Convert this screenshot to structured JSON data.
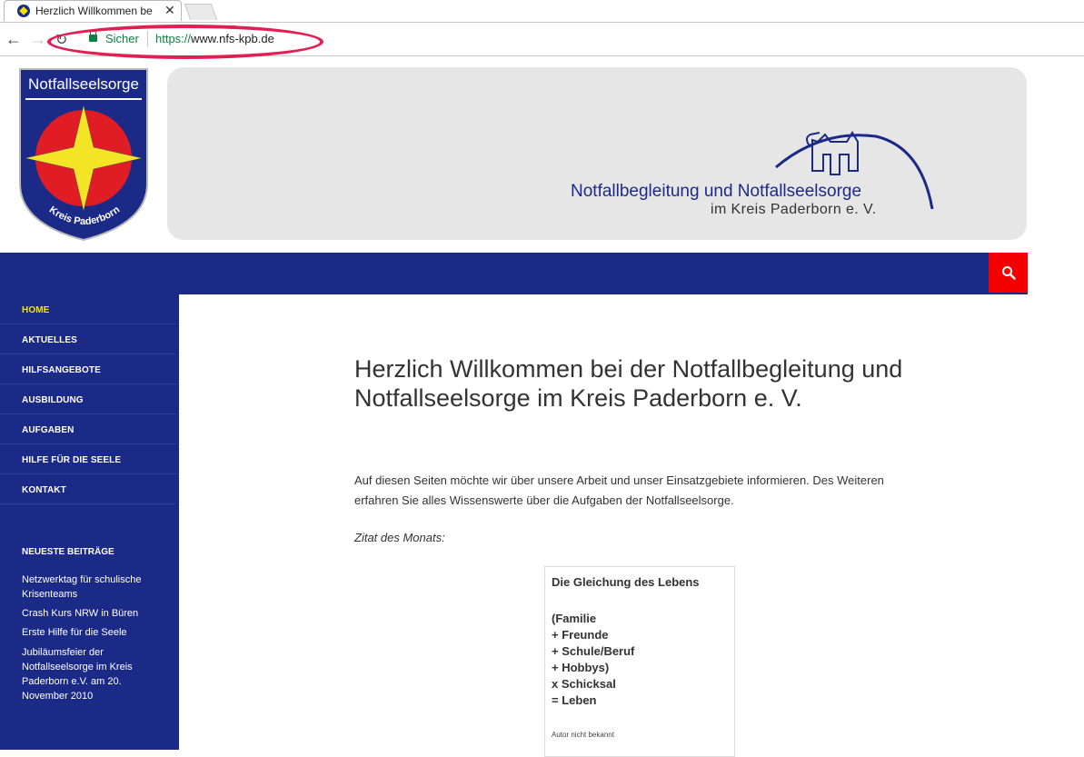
{
  "browser": {
    "tab_title": "Herzlich Willkommen be",
    "tab_close": "✕",
    "secure_label": "Sicher",
    "url_scheme": "https://",
    "url_host": "www.nfs-kpb.de",
    "highlight_color": "#e11f52"
  },
  "logo": {
    "top_text": "Notfallseelsorge",
    "bottom_text": "Kreis Paderborn"
  },
  "banner": {
    "line1": "Notfallbegleitung und Notfallseelsorge",
    "line2": "im Kreis Paderborn e. V."
  },
  "colors": {
    "brand_blue": "#1c2a87",
    "active_yellow": "#f6e600",
    "search_red": "#f30000"
  },
  "menu": {
    "items": [
      {
        "label": "HOME",
        "active": true
      },
      {
        "label": "AKTUELLES"
      },
      {
        "label": "HILFSANGEBOTE"
      },
      {
        "label": "AUSBILDUNG"
      },
      {
        "label": "AUFGABEN"
      },
      {
        "label": "HILFE FÜR DIE SEELE"
      },
      {
        "label": "KONTAKT"
      }
    ]
  },
  "widget": {
    "title": "NEUESTE BEITRÄGE",
    "posts": [
      "Netzwerktag für schulische Krisenteams",
      "Crash Kurs NRW in Büren",
      "Erste Hilfe für die Seele",
      "Jubiläumsfeier der Notfallseelsorge im Kreis Paderborn e.V. am 20. November 2010"
    ]
  },
  "content": {
    "heading": "Herzlich Willkommen bei der Notfallbegleitung und Notfallseelsorge im Kreis Paderborn e. V.",
    "intro": "Auf diesen Seiten möchte wir über unsere Arbeit und  unser Einsatzgebiete informieren. Des Weiteren erfahren Sie alles Wissenswerte über die Aufgaben der Notfallseelsorge.",
    "quote_label": "Zitat des Monats:",
    "quote": {
      "title": "Die Gleichung des Lebens",
      "lines": [
        "(Familie",
        "+ Freunde",
        "+ Schule/Beruf",
        "+ Hobbys)",
        "x Schicksal",
        "= Leben"
      ],
      "author": "Autor nicht bekannt"
    }
  }
}
